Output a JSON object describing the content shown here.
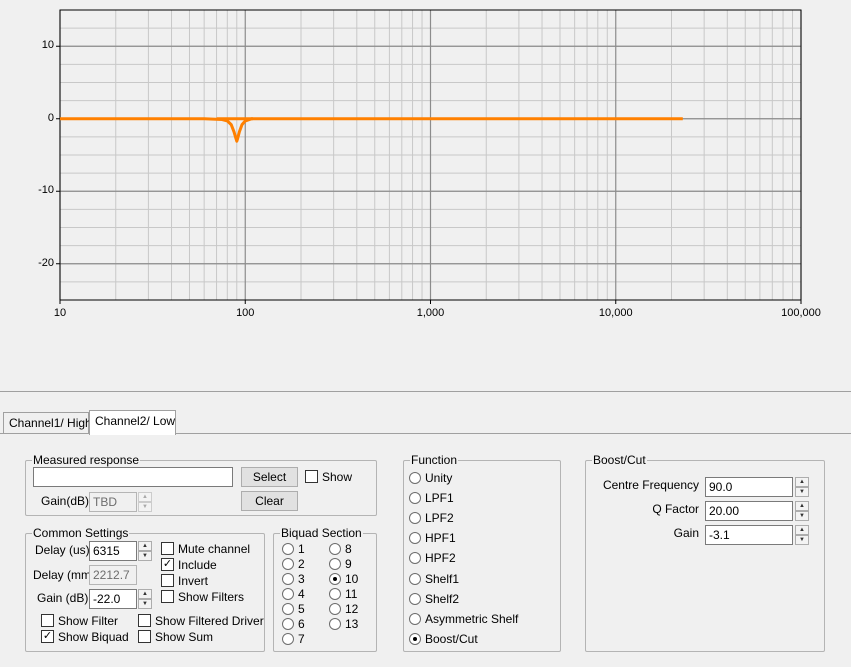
{
  "chart_data": {
    "type": "line",
    "xscale": "log",
    "xlim": [
      10,
      100000
    ],
    "ylim": [
      -25,
      15
    ],
    "yticks": [
      {
        "value": 10,
        "label": "10"
      },
      {
        "value": 0,
        "label": "0"
      },
      {
        "value": -10,
        "label": "-10"
      },
      {
        "value": -20,
        "label": "-20"
      }
    ],
    "xticks": [
      {
        "value": 10,
        "label": "10"
      },
      {
        "value": 100,
        "label": "100"
      },
      {
        "value": 1000,
        "label": "1,000"
      },
      {
        "value": 10000,
        "label": "10,000"
      },
      {
        "value": 100000,
        "label": "100,000"
      }
    ],
    "grid": true,
    "series": [
      {
        "color": "#ff8000",
        "x": [
          10,
          60,
          75,
          80,
          84,
          87,
          89,
          90,
          91,
          93,
          96,
          100,
          108,
          20000,
          23000
        ],
        "y": [
          0,
          0,
          -0.1,
          -0.3,
          -0.8,
          -1.8,
          -2.7,
          -3.1,
          -2.7,
          -1.8,
          -0.8,
          -0.3,
          0,
          0,
          0
        ]
      },
      {
        "color": "#ff8000",
        "x": [
          70,
          110
        ],
        "y": [
          0,
          0
        ]
      }
    ]
  },
  "tabs": [
    {
      "label": "Channel1/ High",
      "active": false
    },
    {
      "label": "Channel2/ Low",
      "active": true
    }
  ],
  "measured": {
    "legend": "Measured response",
    "path_value": "",
    "select_label": "Select",
    "show_label": "Show",
    "show_checked": false,
    "gain_label": "Gain(dB)",
    "gain_value": "TBD",
    "clear_label": "Clear"
  },
  "common": {
    "legend": "Common Settings",
    "delay_us_label": "Delay (us)",
    "delay_us_value": "6315",
    "delay_mm_label": "Delay (mm)",
    "delay_mm_value": "2212.7",
    "gain_label": "Gain (dB)",
    "gain_value": "-22.0",
    "mute_label": "Mute channel",
    "include_label": "Include",
    "invert_label": "Invert",
    "show_filters_label": "Show Filters",
    "show_filter_label": "Show Filter",
    "show_filtered_driver_label": "Show Filtered Driver",
    "show_biquad_label": "Show Biquad",
    "show_sum_label": "Show Sum",
    "mute_checked": false,
    "include_checked": true,
    "invert_checked": false,
    "show_filters_checked": false,
    "show_filter_checked": false,
    "show_filtered_driver_checked": false,
    "show_biquad_checked": true,
    "show_sum_checked": false
  },
  "biquad": {
    "legend": "Biquad Section",
    "options": [
      "1",
      "2",
      "3",
      "4",
      "5",
      "6",
      "7",
      "8",
      "9",
      "10",
      "11",
      "12",
      "13"
    ],
    "selected": "10"
  },
  "function": {
    "legend": "Function",
    "options": [
      "Unity",
      "LPF1",
      "LPF2",
      "HPF1",
      "HPF2",
      "Shelf1",
      "Shelf2",
      "Asymmetric Shelf",
      "Boost/Cut"
    ],
    "selected": "Boost/Cut"
  },
  "boostcut": {
    "legend": "Boost/Cut",
    "freq_label": "Centre Frequency",
    "freq_value": "90.0",
    "q_label": "Q Factor",
    "q_value": "20.00",
    "gain_label": "Gain",
    "gain_value": "-3.1"
  }
}
